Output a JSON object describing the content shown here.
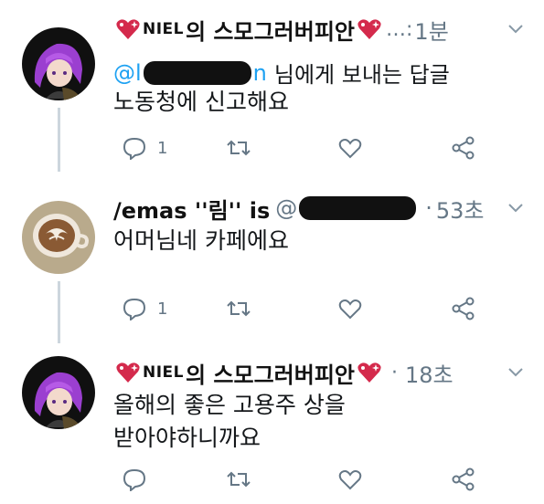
{
  "colors": {
    "accent": "#1da1f2",
    "muted": "#657786",
    "text": "#14171a",
    "heart_red": "#e0245e"
  },
  "tweets": [
    {
      "avatar": "purple-hair-anime-avatar",
      "display_name": "NIEL의 스모그러버피안",
      "name_badge": "NIEL",
      "name_suffix": "의 스모그러버피안",
      "emoji": "sparkling-heart",
      "separator": "…:",
      "time": "1분",
      "reply_prefix": "@l",
      "reply_suffix": "n",
      "reply_text": "님에게 보내는 답글",
      "lines": [
        "노동청에 신고해요"
      ],
      "reply_count": "1",
      "retweet_count": "",
      "like_count": "",
      "icons": [
        "reply-icon",
        "retweet-icon",
        "like-icon",
        "share-icon"
      ]
    },
    {
      "avatar": "latte-art-avatar",
      "display_name": "/emas ''림'' is",
      "handle_prefix": "@",
      "handle_suffix": "·",
      "time": "53초",
      "lines": [
        "어머님네 카페에요"
      ],
      "reply_count": "1",
      "icons": [
        "reply-icon",
        "retweet-icon",
        "like-icon",
        "share-icon"
      ]
    },
    {
      "avatar": "purple-hair-anime-avatar",
      "name_badge": "NIEL",
      "name_suffix": "의 스모그러버피안",
      "separator": "·",
      "time": "18초",
      "lines": [
        "올해의 좋은 고용주 상을",
        "받아야하니까요"
      ],
      "reply_count": "",
      "icons": [
        "reply-icon",
        "retweet-icon",
        "like-icon",
        "share-icon"
      ]
    }
  ]
}
